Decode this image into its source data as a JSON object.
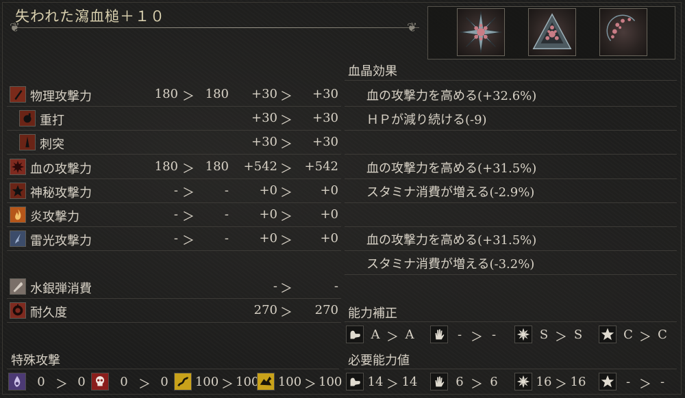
{
  "weapon_name": "失われた瀉血槌＋１０",
  "gem_slots": [
    {
      "name": "gem-radial-icon"
    },
    {
      "name": "gem-triangle-icon"
    },
    {
      "name": "gem-waning-icon"
    }
  ],
  "attack": [
    {
      "icon": "physical-attack-icon",
      "label": "物理攻撃力",
      "base_from": "180",
      "arrow1": "＞",
      "base_to": "180",
      "bonus_from": "+30",
      "arrow2": "＞",
      "bonus_to": "+30"
    },
    {
      "icon": "blunt-icon",
      "label": "重打",
      "base_from": "",
      "arrow1": "",
      "base_to": "",
      "bonus_from": "+30",
      "arrow2": "＞",
      "bonus_to": "+30"
    },
    {
      "icon": "thrust-icon",
      "label": "刺突",
      "base_from": "",
      "arrow1": "",
      "base_to": "",
      "bonus_from": "+30",
      "arrow2": "＞",
      "bonus_to": "+30"
    },
    {
      "icon": "blood-attack-icon",
      "label": "血の攻撃力",
      "base_from": "180",
      "arrow1": "＞",
      "base_to": "180",
      "bonus_from": "+542",
      "arrow2": "＞",
      "bonus_to": "+542"
    },
    {
      "icon": "arcane-attack-icon",
      "label": "神秘攻撃力",
      "base_from": "-",
      "arrow1": "＞",
      "base_to": "-",
      "bonus_from": "+0",
      "arrow2": "＞",
      "bonus_to": "+0"
    },
    {
      "icon": "fire-attack-icon",
      "label": "炎攻撃力",
      "base_from": "-",
      "arrow1": "＞",
      "base_to": "-",
      "bonus_from": "+0",
      "arrow2": "＞",
      "bonus_to": "+0"
    },
    {
      "icon": "bolt-attack-icon",
      "label": "雷光攻撃力",
      "base_from": "-",
      "arrow1": "＞",
      "base_to": "-",
      "bonus_from": "+0",
      "arrow2": "＞",
      "bonus_to": "+0"
    }
  ],
  "extra_stats": [
    {
      "icon": "quicksilver-bullet-icon",
      "label": "水銀弾消費",
      "from": "-",
      "arrow": "＞",
      "to": "-"
    },
    {
      "icon": "durability-icon",
      "label": "耐久度",
      "from": "270",
      "arrow": "＞",
      "to": "270"
    }
  ],
  "special_attack": {
    "title": "特殊攻撃",
    "items": [
      {
        "icon": "slow-poison-icon",
        "from": "0",
        "arrow": "＞",
        "to": "0"
      },
      {
        "icon": "rapid-poison-icon",
        "from": "0",
        "arrow": "＞",
        "to": "0"
      },
      {
        "icon": "serrated-icon",
        "from": "100",
        "arrow": "＞",
        "to": "100"
      },
      {
        "icon": "righteous-icon",
        "from": "100",
        "arrow": "＞",
        "to": "100"
      }
    ]
  },
  "blood_gem_effects": {
    "title": "血晶効果",
    "lines": [
      "血の攻撃力を高める(+32.6%)",
      "ＨＰが減り続ける(-9)",
      "",
      "血の攻撃力を高める(+31.5%)",
      "スタミナ消費が増える(-2.9%)",
      "",
      "血の攻撃力を高める(+31.5%)",
      "スタミナ消費が増える(-3.2%)"
    ]
  },
  "scaling": {
    "title": "能力補正",
    "items": [
      {
        "icon": "strength-icon",
        "from": "A",
        "arrow": "＞",
        "to": "A"
      },
      {
        "icon": "skill-icon",
        "from": "-",
        "arrow": "＞",
        "to": "-"
      },
      {
        "icon": "bloodtinge-icon",
        "from": "S",
        "arrow": "＞",
        "to": "S"
      },
      {
        "icon": "arcane-icon",
        "from": "C",
        "arrow": "＞",
        "to": "C"
      }
    ]
  },
  "requirements": {
    "title": "必要能力値",
    "items": [
      {
        "icon": "strength-icon",
        "from": "14",
        "arrow": "＞",
        "to": "14"
      },
      {
        "icon": "skill-icon",
        "from": "6",
        "arrow": "＞",
        "to": "6"
      },
      {
        "icon": "bloodtinge-icon",
        "from": "16",
        "arrow": "＞",
        "to": "16"
      },
      {
        "icon": "arcane-icon",
        "from": "-",
        "arrow": "＞",
        "to": "-"
      }
    ]
  }
}
